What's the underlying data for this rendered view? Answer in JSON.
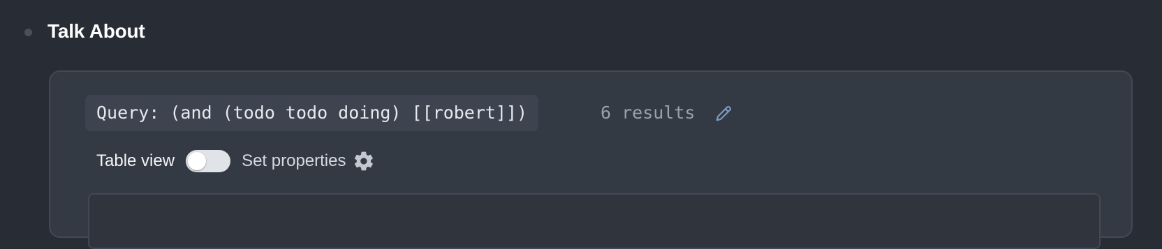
{
  "block": {
    "title": "Talk About"
  },
  "query": {
    "text": "Query: (and (todo todo doing) [[robert]])",
    "results": "6 results"
  },
  "controls": {
    "table_view_label": "Table view",
    "table_view_enabled": false,
    "set_properties_label": "Set properties"
  },
  "icons": {
    "edit": "pencil-icon",
    "settings": "gear-icon"
  },
  "colors": {
    "background": "#282c34",
    "panel": "#343a43",
    "accent_icon": "#7d9cc4"
  }
}
